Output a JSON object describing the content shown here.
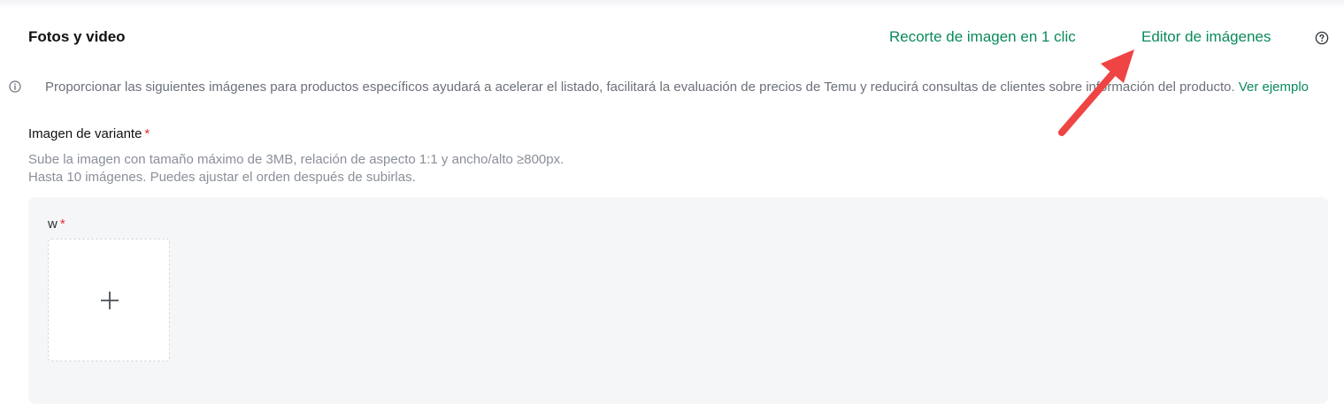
{
  "section": {
    "title": "Fotos y video",
    "crop_link": "Recorte de imagen en 1 clic",
    "editor_link": "Editor de imágenes",
    "help_icon": "question-circle-icon"
  },
  "info": {
    "icon": "info-circle-icon",
    "text": "Proporcionar las siguientes imágenes para productos específicos ayudará a acelerar el listado, facilitará la evaluación de precios de Temu y reducirá consultas de clientes sobre información del producto.",
    "link": "Ver ejemplo"
  },
  "variant_image": {
    "label": "Imagen de variante",
    "required": "*",
    "hint_line1": "Sube la imagen con tamaño máximo de 3MB, relación de aspecto 1:1 y ancho/alto ≥800px.",
    "hint_line2": "Hasta 10 imágenes. Puedes ajustar el orden después de subirlas."
  },
  "upload_panel": {
    "variant_name": "w",
    "required": "*",
    "add_icon": "plus-icon"
  },
  "colors": {
    "link_green": "#0a8a5a",
    "required_red": "#e0302c",
    "annotation_arrow": "#ef4444",
    "panel_bg": "#f5f6f8"
  }
}
